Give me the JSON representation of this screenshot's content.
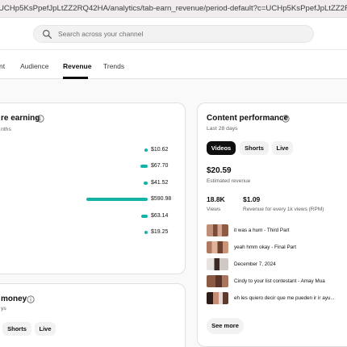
{
  "browser": {
    "url": "UCHp5KsPpefJpLtZZ2RQ42HA/analytics/tab-earn_revenue/period-default?c=UCHp5KsPpefJpLtZZ2RQ42HA"
  },
  "header": {
    "search_placeholder": "Search across your channel"
  },
  "tabs": [
    {
      "label": "nt"
    },
    {
      "label": "Audience"
    },
    {
      "label": "Revenue",
      "active": true
    },
    {
      "label": "Trends"
    }
  ],
  "earning_card": {
    "title": "re earning",
    "subtitle": "nths",
    "bars": [
      {
        "value_label": "$10.62",
        "value": 10.62
      },
      {
        "value_label": "$67.70",
        "value": 67.7
      },
      {
        "value_label": "$41.52",
        "value": 41.52
      },
      {
        "value_label": "$590.98",
        "value": 590.98
      },
      {
        "value_label": "$63.14",
        "value": 63.14
      },
      {
        "value_label": "$19.25",
        "value": 19.25
      }
    ]
  },
  "money_card": {
    "title": "money",
    "subtitle": "ys",
    "chips": [
      "Shorts",
      "Live"
    ]
  },
  "content_card": {
    "title": "Content performance",
    "subtitle": "Last 28 days",
    "chips": [
      {
        "label": "Videos",
        "active": true
      },
      {
        "label": "Shorts",
        "active": false
      },
      {
        "label": "Live",
        "active": false
      }
    ],
    "revenue_value": "$20.59",
    "revenue_label": "Estimated revenue",
    "views_value": "18.8K",
    "views_label": "Views",
    "rpm_value": "$1.09",
    "rpm_label": "Revenue for every 1k views (RPM)",
    "videos": [
      {
        "title": "it was a hum - Third Part"
      },
      {
        "title": "yeah hmm okay - Final Part"
      },
      {
        "title": "December 7, 2024"
      },
      {
        "title": "Cindy to your list contestant - Amay Mua"
      },
      {
        "title": "eh les quiero decir que me pueden ir ir ayu..."
      }
    ],
    "see_more": "See more"
  }
}
